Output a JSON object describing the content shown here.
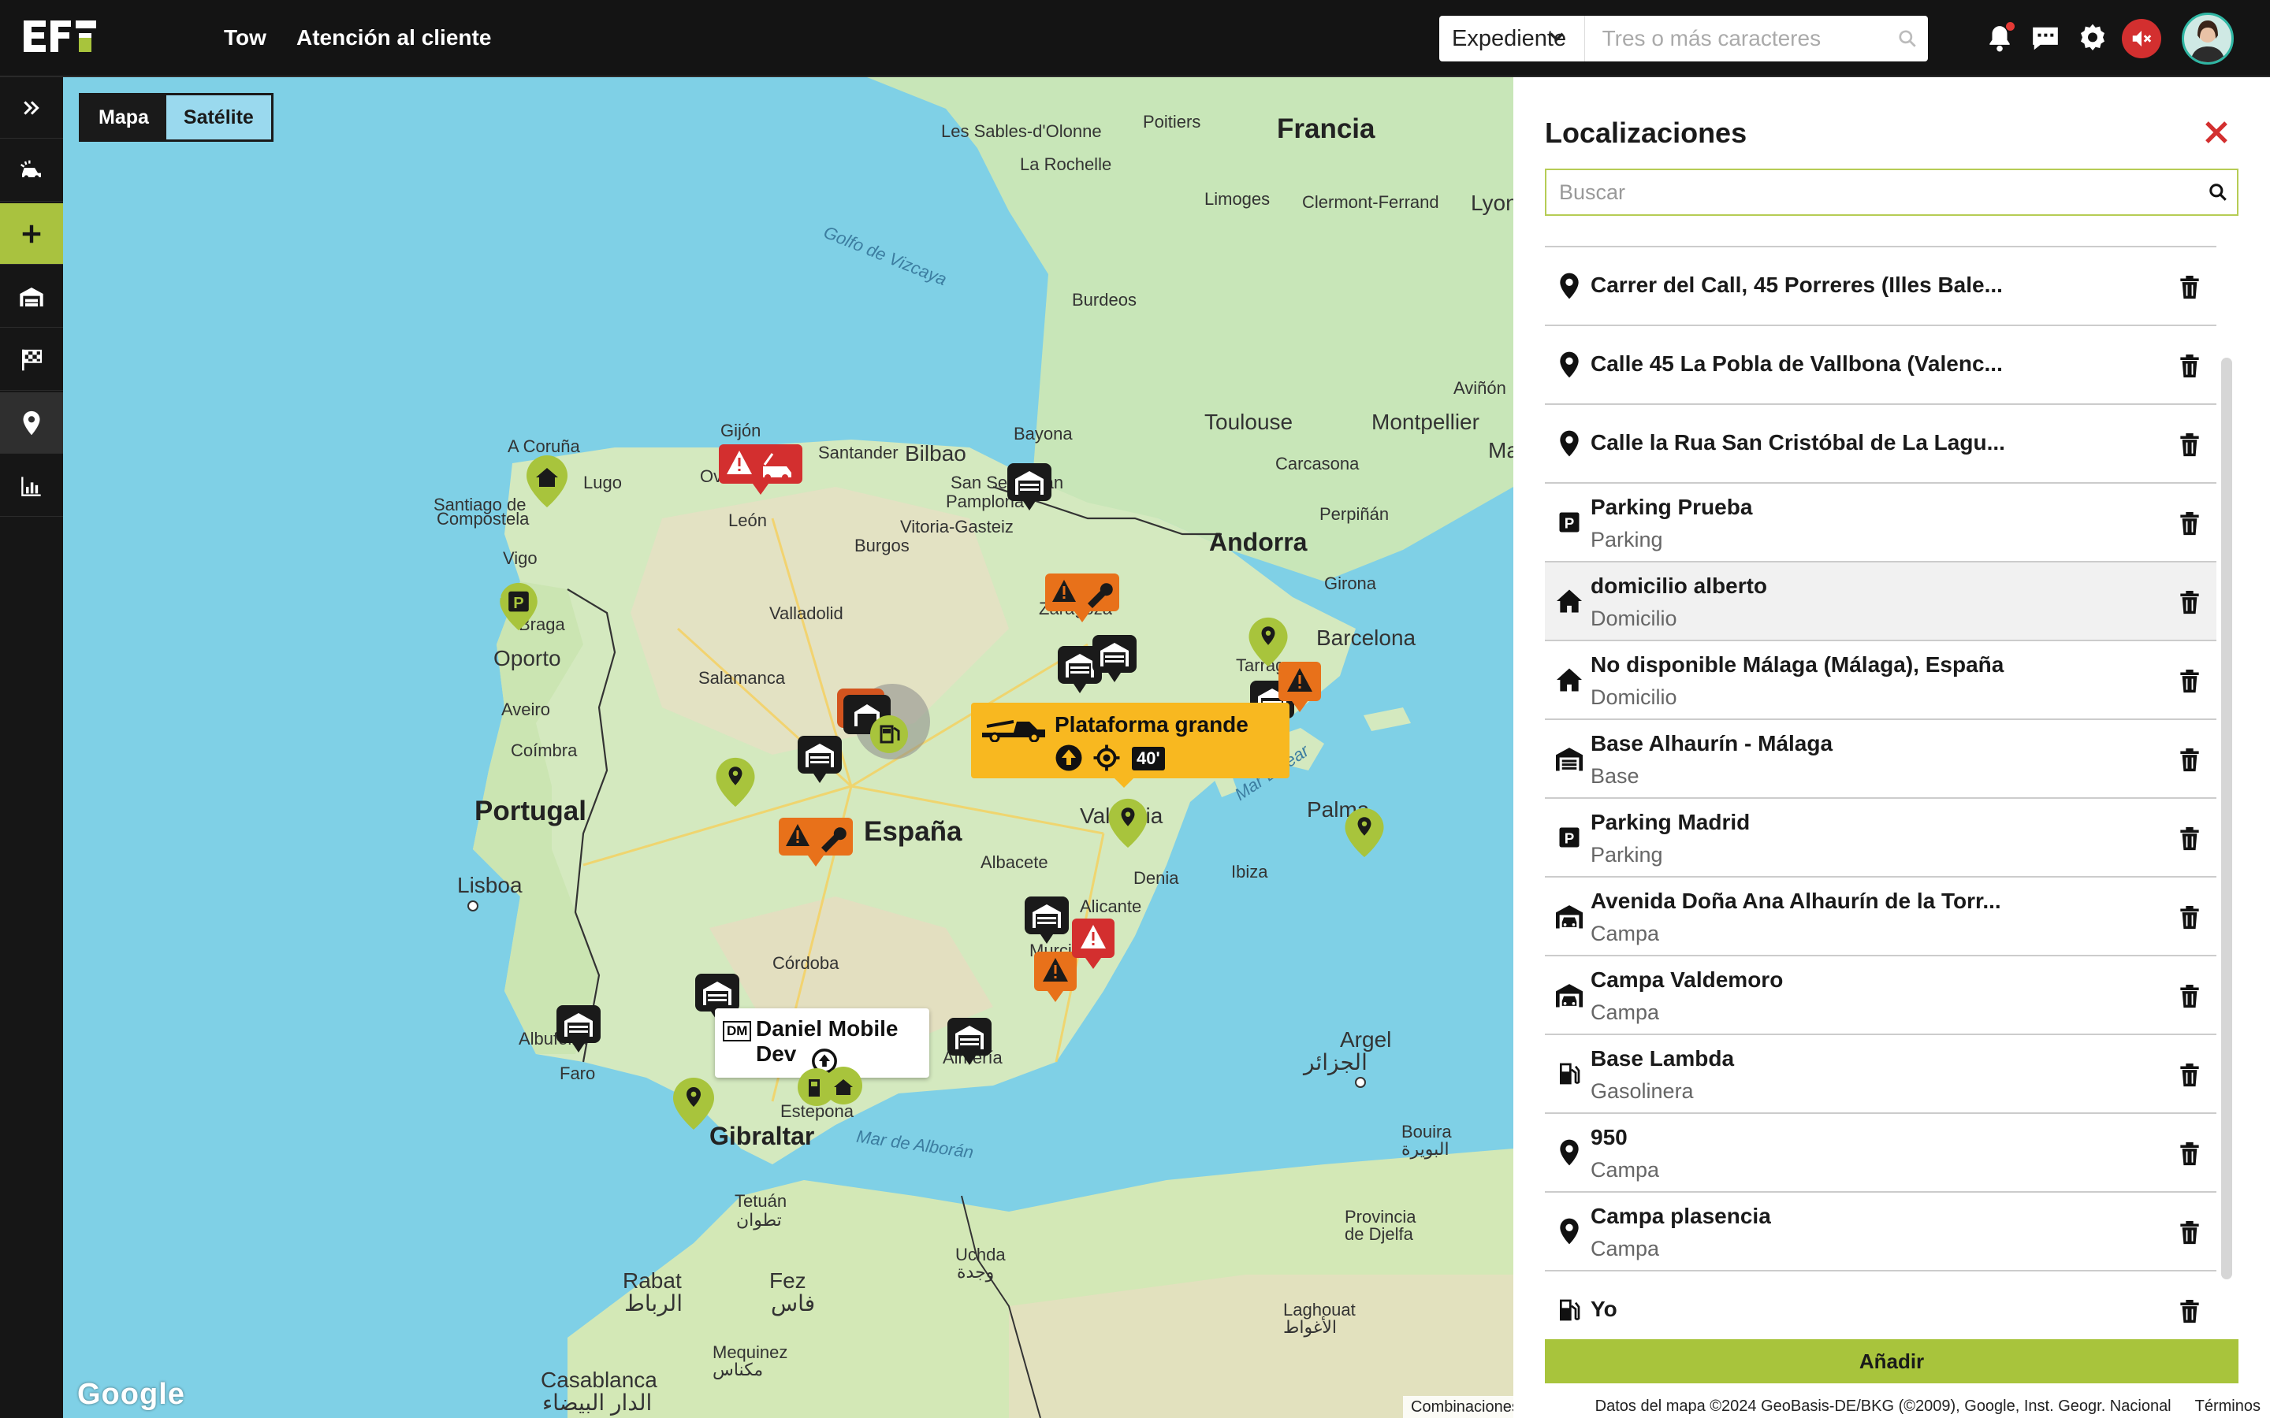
{
  "header": {
    "nav": [
      "Tow",
      "Atención al cliente"
    ],
    "search": {
      "selected": "Expediente",
      "placeholder": "Tres o más caracteres"
    }
  },
  "sidebar": {
    "items": [
      {
        "icon": "double-chevron-right-icon"
      },
      {
        "icon": "car-crash-icon"
      },
      {
        "icon": "plus-icon",
        "active": true
      },
      {
        "icon": "garage-icon"
      },
      {
        "icon": "checkered-flag-icon"
      },
      {
        "icon": "location-pin-icon",
        "selected": true
      },
      {
        "icon": "bar-chart-icon"
      }
    ]
  },
  "map": {
    "toggle": [
      "Mapa",
      "Satélite"
    ],
    "labels": {
      "countries": [
        "Francia",
        "Portugal",
        "España",
        "Andorra",
        "Gibraltar"
      ],
      "cities": [
        "Les Sables-d'Olonne",
        "La Rochelle",
        "Poitiers",
        "Limoges",
        "Clermont-Ferrand",
        "Lyon",
        "Burdeos",
        "Toulouse",
        "Montpellier",
        "Carcasona",
        "Perpiñán",
        "Aviñón",
        "Ma",
        "Bayona",
        "San Sebastián",
        "Pamplona",
        "Bilbao",
        "Vitoria-Gasteiz",
        "Gijón",
        "Santander",
        "Oviedo",
        "León",
        "Burgos",
        "A Coruña",
        "Lugo",
        "Santiago de",
        "Compostela",
        "Vigo",
        "Braga",
        "Oporto",
        "Aveiro",
        "Coímbra",
        "Valladolid",
        "Salamanca",
        "Zaragoza",
        "Tarragona",
        "Barcelona",
        "Girona",
        "Lisboa",
        "Albacete",
        "Valencia",
        "Denia",
        "Ibiza",
        "Palma",
        "Alicante",
        "Murcia",
        "Córdoba",
        "Albufeira",
        "Faro",
        "Almería",
        "Estepona",
        "Tetuán",
        "Rabat",
        "Fez",
        "Uchda",
        "Argel",
        "Bouira",
        "Provincia",
        "de Djelfa",
        "Laghouat",
        "Casablanca",
        "Mequinez"
      ],
      "seas": [
        "Golfo de Vizcaya",
        "Mar Balear",
        "Mar de Alborán"
      ],
      "arabic": [
        "تطوان",
        "الرباط",
        "فاس",
        "وجدة",
        "الجزائر",
        "البويرة",
        "الأغواط",
        "الدار البيضاء",
        "مكناس"
      ]
    },
    "yellow_card": {
      "title": "Plataforma grande",
      "badge": "40'"
    },
    "white_card": {
      "tag": "DM",
      "title": "Daniel Mobile Dev"
    },
    "google": "Google",
    "attribution": [
      "Combinaciones de teclas",
      "Datos del mapa ©2024 GeoBasis-DE/BKG (©2009), Google, Inst. Geogr. Nacional",
      "Términos"
    ]
  },
  "panel": {
    "title": "Localizaciones",
    "search_placeholder": "Buscar",
    "add_label": "Añadir",
    "items": [
      {
        "icon": "map-pin-icon",
        "name": "Carrer del Call, 45 Porreres (Illes Bale...",
        "sub": ""
      },
      {
        "icon": "map-pin-icon",
        "name": "Calle 45 La Pobla de Vallbona (Valenc...",
        "sub": ""
      },
      {
        "icon": "map-pin-icon",
        "name": "Calle la Rua San Cristóbal de La Lagu...",
        "sub": ""
      },
      {
        "icon": "parking-icon",
        "name": "Parking Prueba",
        "sub": "Parking"
      },
      {
        "icon": "home-icon",
        "name": "domicilio alberto",
        "sub": "Domicilio",
        "highlight": true
      },
      {
        "icon": "home-icon",
        "name": "No disponible Málaga (Málaga), España",
        "sub": "Domicilio"
      },
      {
        "icon": "warehouse-icon",
        "name": "Base Alhaurín - Málaga",
        "sub": "Base"
      },
      {
        "icon": "parking-icon",
        "name": "Parking Madrid",
        "sub": "Parking"
      },
      {
        "icon": "garage-car-icon",
        "name": "Avenida Doña Ana Alhaurín de la Torr...",
        "sub": "Campa"
      },
      {
        "icon": "garage-car-icon",
        "name": "Campa Valdemoro",
        "sub": "Campa"
      },
      {
        "icon": "gas-pump-icon",
        "name": "Base Lambda",
        "sub": "Gasolinera"
      },
      {
        "icon": "map-pin-icon",
        "name": "950",
        "sub": "Campa"
      },
      {
        "icon": "map-pin-icon",
        "name": "Campa plasencia",
        "sub": "Campa"
      },
      {
        "icon": "gas-pump-icon",
        "name": "Yo",
        "sub": ""
      }
    ]
  }
}
